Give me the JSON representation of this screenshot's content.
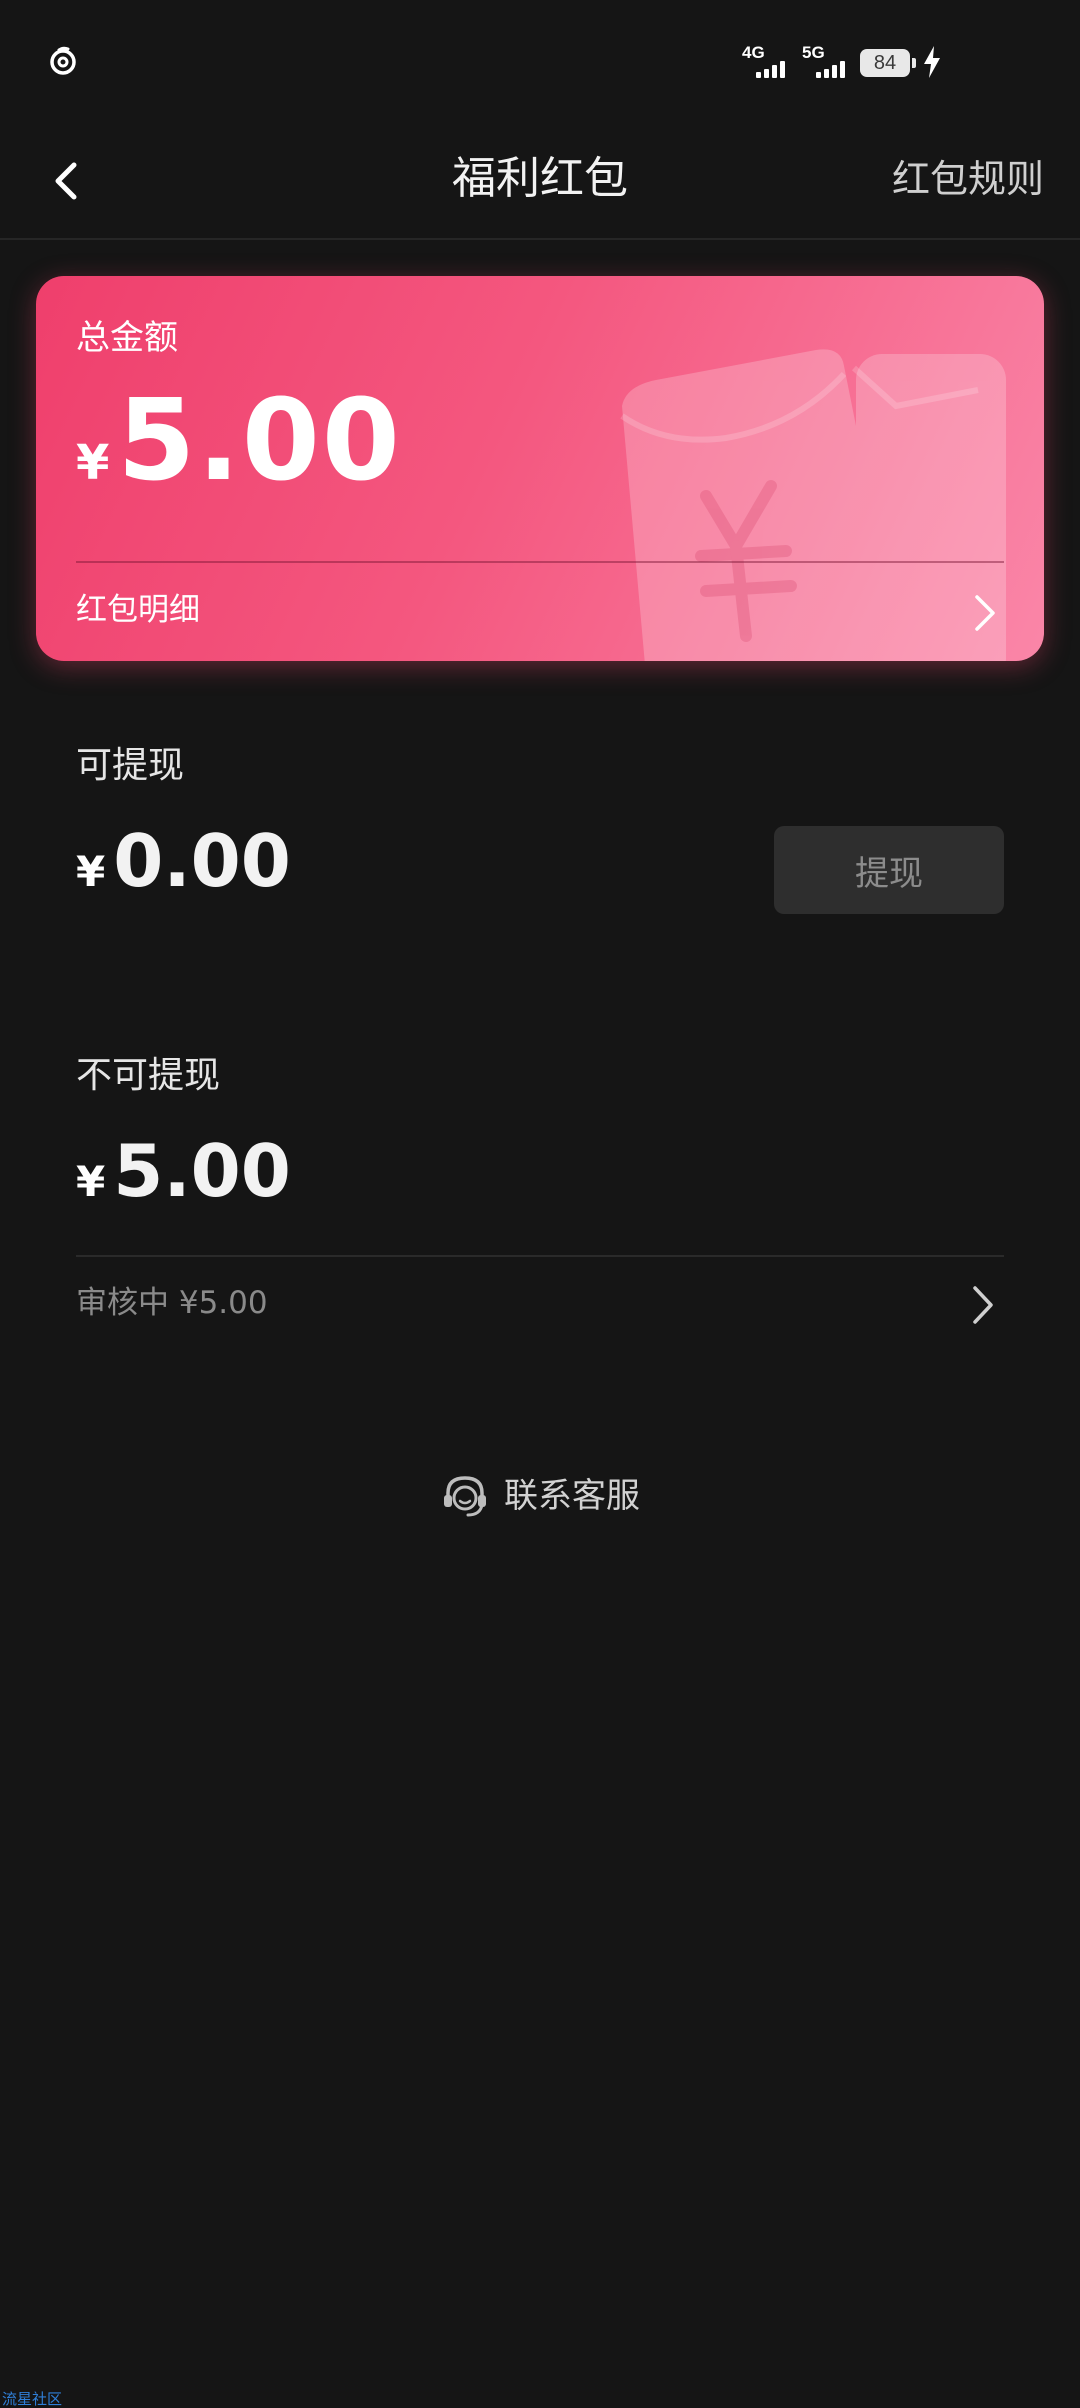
{
  "status_bar": {
    "network_1": "4G",
    "network_2": "5G",
    "battery": "84"
  },
  "nav": {
    "title": "福利红包",
    "rules_link": "红包规则"
  },
  "total_card": {
    "label": "总金额",
    "currency": "¥",
    "amount": "5.00",
    "detail_label": "红包明细"
  },
  "withdrawable": {
    "label": "可提现",
    "currency": "¥",
    "amount": "0.00",
    "button_label": "提现"
  },
  "non_withdrawable": {
    "label": "不可提现",
    "currency": "¥",
    "amount": "5.00",
    "review_text": "审核中 ¥5.00"
  },
  "service": {
    "label": "联系客服"
  },
  "watermark": "流星社区",
  "colors": {
    "background": "#151515",
    "card_gradient_start": "#ef3f6c",
    "card_gradient_end": "#fa86a8",
    "button_disabled": "#2e2e2e"
  },
  "icons": [
    "app-logo-icon",
    "bolt-icon",
    "back-arrow-icon",
    "red-envelope-icon",
    "chevron-right-icon",
    "headset-icon"
  ]
}
